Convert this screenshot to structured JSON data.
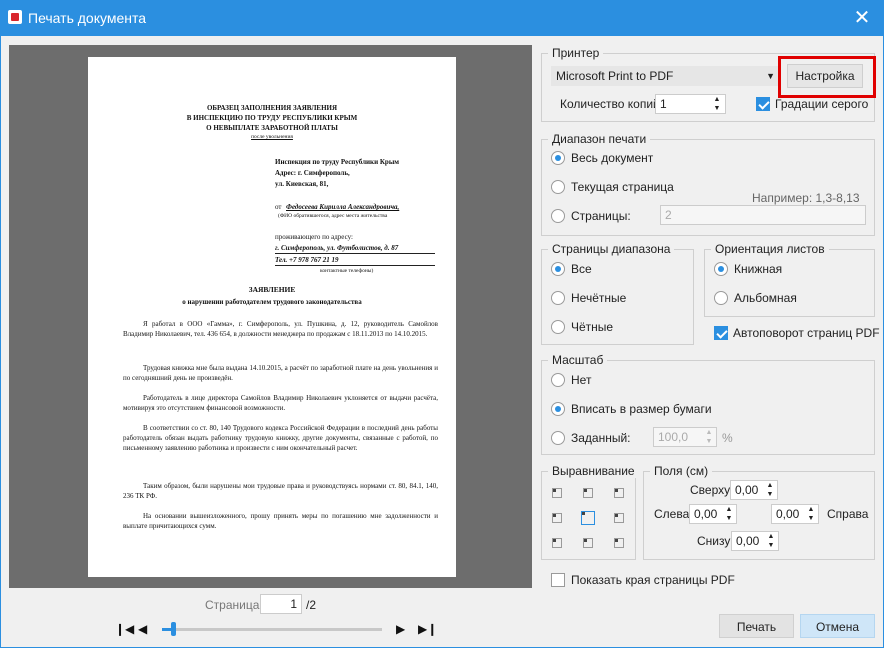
{
  "window": {
    "title": "Печать документа",
    "close": "✕"
  },
  "preview": {
    "page": {
      "heading": [
        "ОБРАЗЕЦ ЗАПОЛНЕНИЯ ЗАЯВЛЕНИЯ",
        "В ИНСПЕКЦИЮ ПО ТРУДУ РЕСПУБЛИКИ КРЫМ",
        "О НЕВЫПЛАТЕ ЗАРАБОТНОЙ ПЛАТЫ"
      ],
      "heading_sub": "после увольнения",
      "addressee": [
        "Инспекция по труду Республики Крым",
        "Адрес: г. Симферополь,",
        "ул. Киевская, 81,"
      ],
      "from_prefix": "от",
      "from_name": "Федосеева Кирилла Александровича,",
      "from_note": "(ФИО обратившегося, адрес места жительства",
      "residence_label": "проживающего по адресу:",
      "residence_address": "г. Симферополь, ул. Футболистов, д. 87",
      "phone": "Тел. +7 978 767 21 19",
      "phone_note": "контактные телефоны)",
      "doc_title": "ЗАЯВЛЕНИЕ",
      "doc_subtitle": "о нарушении работодателем трудового законодательства",
      "paragraphs": [
        "Я работал в ООО «Гамма», г. Симферополь, ул. Пушкина, д. 12, руководитель Самойлов Владимир Николаевич, тел. 436 654, в должности менеджера по продажам с 18.11.2013 по 14.10.2015.",
        "Трудовая книжка мне была выдана 14.10.2015, а расчёт по заработной плате на день увольнения и по сегодняшний день не произведён.",
        "Работодатель в лице директора Самойлов Владимир Николаевич уклоняется от выдачи расчёта, мотивируя это отсутствием финансовой возможности.",
        "В соответствии со ст. 80, 140 Трудового кодекса Российской Федерации в последний день работы работодатель обязан выдать работнику трудовую книжку, другие документы, связанные с работой, по письменному заявлению работника и произвести с ним окончательный расчет.",
        "Таким образом, были нарушены мои трудовые права и руководствуясь нормами ст. 80, 84.1, 140, 236 ТК РФ.",
        "На основании вышеизложенного, прошу принять меры по погашению мне задолженности и выплате причитающихся сумм."
      ]
    },
    "pager": {
      "label": "Страница:",
      "current": "1",
      "total": "/2",
      "progress": 0.05
    }
  },
  "printer": {
    "legend": "Принтер",
    "selected": "Microsoft Print to PDF",
    "settings_button": "Настройка",
    "copies_label": "Количество копий",
    "copies_value": "1",
    "grayscale_label": "Градации серого",
    "grayscale_checked": true,
    "highlight_color": "#e00000"
  },
  "range": {
    "legend": "Диапазон печати",
    "all": "Весь документ",
    "current": "Текущая страница",
    "pages": "Страницы:",
    "example": "Например: 1,3-8,13",
    "pages_value": "2",
    "selected": "all"
  },
  "subset": {
    "legend": "Страницы диапазона",
    "all": "Все",
    "odd": "Нечётные",
    "even": "Чётные",
    "selected": "all"
  },
  "orientation": {
    "legend": "Ориентация листов",
    "portrait": "Книжная",
    "landscape": "Альбомная",
    "selected": "portrait",
    "autorotate": "Автоповорот страниц PDF",
    "autorotate_checked": true
  },
  "scale": {
    "legend": "Масштаб",
    "none": "Нет",
    "fit": "Вписать в размер бумаги",
    "custom": "Заданный:",
    "custom_value": "100,0",
    "percent": "%",
    "selected": "fit"
  },
  "alignment": {
    "legend": "Выравнивание",
    "selected": "center"
  },
  "margins": {
    "legend": "Поля (см)",
    "top": "Сверху",
    "left": "Слева",
    "right": "Справа",
    "bottom": "Снизу",
    "top_value": "0,00",
    "left_value": "0,00",
    "right_value": "0,00",
    "bottom_value": "0,00"
  },
  "show_edges": {
    "label": "Показать края страницы PDF",
    "checked": false
  },
  "buttons": {
    "print": "Печать",
    "cancel": "Отмена"
  },
  "icons": {
    "first": "first-page-icon",
    "prev": "prev-page-icon",
    "next": "next-page-icon",
    "last": "last-page-icon"
  },
  "colors": {
    "accent": "#2b8fe0",
    "preview_bg": "#6d6d6d"
  }
}
